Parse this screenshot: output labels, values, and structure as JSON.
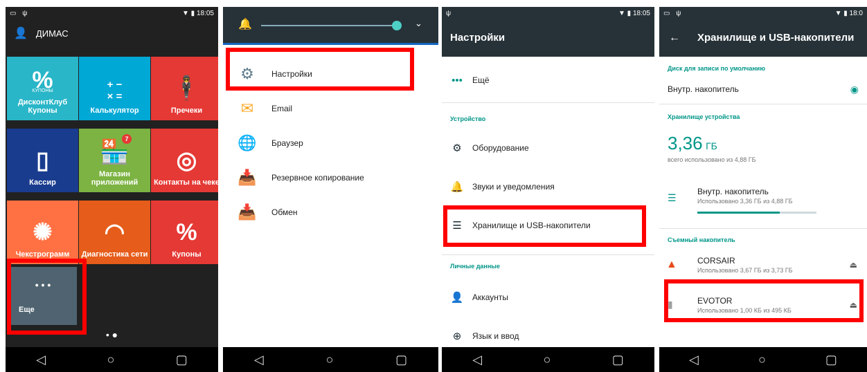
{
  "panel1": {
    "status_time": "18:05",
    "user_name": "ДИМАС",
    "tiles": [
      {
        "label": "ДисконтКлуб Купоны",
        "icon": "%",
        "sub": "КУПОНЫ",
        "color": "#29b6c8"
      },
      {
        "label": "Калькулятор",
        "icon": "+ −\n× =",
        "color": "#00a8d6"
      },
      {
        "label": "Пречеки",
        "icon": "🕴",
        "color": "#e53935"
      },
      {
        "label": "Кассир",
        "icon": "▯",
        "color": "#1a3c8f"
      },
      {
        "label": "Магазин приложений",
        "icon": "🏪",
        "badge": "7",
        "color": "#7cb342"
      },
      {
        "label": "Контакты на чеке",
        "icon": "◎",
        "color": "#e53935"
      },
      {
        "label": "Чекстрограмм",
        "icon": "✺",
        "color": "#ff7043"
      },
      {
        "label": "Диагностика сети",
        "icon": "◠",
        "color": "#e65c1a"
      },
      {
        "label": "Купоны",
        "icon": "%",
        "color": "#e53935"
      }
    ],
    "more_label": "Еще",
    "more_dots": "• • •",
    "page_dots": "• ●"
  },
  "panel2": {
    "menu": [
      {
        "label": "Настройки",
        "icon": "gear-icon",
        "glyph": "⚙",
        "color": "#607d8b"
      },
      {
        "label": "Email",
        "icon": "email-icon",
        "glyph": "✉",
        "color": "#f9a825"
      },
      {
        "label": "Браузер",
        "icon": "globe-icon",
        "glyph": "🌐",
        "color": "#1565c0"
      },
      {
        "label": "Резервное копирование",
        "icon": "backup-icon",
        "glyph": "📥",
        "color": "#e53935"
      },
      {
        "label": "Обмен",
        "icon": "exchange-icon",
        "glyph": "📥",
        "color": "#e53935"
      }
    ]
  },
  "panel3": {
    "status_time": "18:05",
    "title": "Настройки",
    "more": "Ещё",
    "section_device": "Устройство",
    "section_personal": "Личные данные",
    "items": [
      {
        "label": "Оборудование",
        "icon": "gear-icon",
        "glyph": "⚙"
      },
      {
        "label": "Звуки и уведомления",
        "icon": "bell-icon",
        "glyph": "🔔"
      },
      {
        "label": "Хранилище и USB-накопители",
        "icon": "storage-icon",
        "glyph": "☰"
      }
    ],
    "personal_items": [
      {
        "label": "Аккаунты",
        "icon": "account-icon",
        "glyph": "👤"
      },
      {
        "label": "Язык и ввод",
        "icon": "globe-icon",
        "glyph": "⊕"
      }
    ]
  },
  "panel4": {
    "status_time": "18:0",
    "title": "Хранилище и USB-накопители",
    "default_disk_header": "Диск для записи по умолчанию",
    "default_disk": "Внутр. накопитель",
    "device_storage_header": "Хранилище устройства",
    "used_value": "3,36",
    "used_unit": "ГБ",
    "used_total": "всего использовано из 4,88 ГБ",
    "internal_name": "Внутр. накопитель",
    "internal_sub": "Использовано 3,36 ГБ из 4,88 ГБ",
    "internal_fraction": 0.69,
    "removable_header": "Съемный накопитель",
    "drives": [
      {
        "name": "CORSAIR",
        "sub": "Использовано 3,67 ГБ из 3,73 ГБ",
        "icon": "warning-icon"
      },
      {
        "name": "EVOTOR",
        "sub": "Использовано 1,00 КБ из 495 КБ",
        "icon": "sd-card-icon"
      }
    ]
  }
}
